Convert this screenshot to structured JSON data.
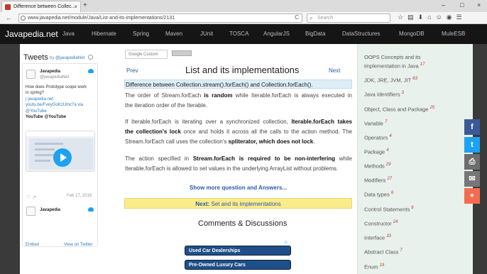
{
  "browser": {
    "tab_title": "Difference between Collec...",
    "tab_close": "×",
    "new_tab": "+",
    "url": "www.javapedia.net/module/Java/List-and-its-implementations/2131",
    "search_placeholder": "Search",
    "window_controls": [
      "–",
      "□",
      "×"
    ],
    "toolbar_icons": [
      "☆",
      "▤",
      "⬇",
      "⌂",
      "☺",
      "◉",
      "☰"
    ],
    "back": "←",
    "reload": "C"
  },
  "site": {
    "brand": "Javapedia.net",
    "nav": [
      "Java",
      "Hibernate",
      "Spring",
      "Maven",
      "JUnit",
      "TOSCA",
      "AngularJS",
      "BigData",
      "DataStructures",
      "MongoDB",
      "MuleESB"
    ]
  },
  "twitter": {
    "title": "Tweets",
    "by_prefix": "by",
    "handle": "@javapediaNet",
    "tweet_name": "Javapedia",
    "tweet_handle": "@javapediaNet",
    "tweet_lines": [
      "How does Prototype scope work",
      "in spring?"
    ],
    "tweet_link_lines": [
      "| javapedia.net",
      "youtu.be/FveyGoKzUmc?a via"
    ],
    "tweet_via": "@YouTube",
    "card_source": "YouTube @YouTube",
    "actions": "♡ ↗",
    "date": "Feb 17, 2018",
    "next_name": "Javapedia",
    "embed": "Embed",
    "view": "View on Twitter"
  },
  "main": {
    "search_label": "Google Custom",
    "prev": "Prev",
    "next": "Next",
    "title": "List and its implementations",
    "highlight": "Difference between Collection.stream().forEach() and Collection.forEach().",
    "p1": [
      [
        "The order of Stream.forEach ",
        "is random",
        " while Iterable.forEach is always executed in"
      ],
      [
        "the iteration order of the Iterable."
      ]
    ],
    "p2": [
      [
        "If Iterable.forEach is iterating over a synchronized collection, ",
        "Iterable.forEach takes",
        ""
      ],
      [
        "",
        "the collection's lock",
        " once and holds it across all the calls to the action method. The"
      ],
      [
        "Stream.forEach call uses the collection's ",
        "spliterator, which does not lock",
        "."
      ]
    ],
    "p3": [
      [
        "The action specified in ",
        "Stream.forEach is required to be non-interfering",
        " while"
      ],
      [
        "Iterable.forEach is allowed to set values in the underlying ArrayList without problems."
      ]
    ],
    "show_more": "Show more question and Answers...",
    "next_prefix": "Next:",
    "next_title": "Set and its implementations",
    "comments": "Comments & Discussions",
    "ad_buttons": [
      "Used Car Dealerships",
      "Pre-Owned Luxury Cars"
    ]
  },
  "sidebar": {
    "items": [
      {
        "label": "OOPS Concepts and its",
        "count": ""
      },
      {
        "label": "implementation in Java",
        "count": "17"
      },
      {
        "label": "JDK, JRE, JVM, JIT",
        "count": "63"
      },
      {
        "label": "Java Identifiers",
        "count": "3"
      },
      {
        "label": "Object, Class and Package",
        "count": "25"
      },
      {
        "label": "Variable",
        "count": "7"
      },
      {
        "label": "Operators",
        "count": "4"
      },
      {
        "label": "Package",
        "count": "4"
      },
      {
        "label": "Methods",
        "count": "29"
      },
      {
        "label": "Modifiers",
        "count": "27"
      },
      {
        "label": "Data types",
        "count": "6"
      },
      {
        "label": "Control Statements",
        "count": "6"
      },
      {
        "label": "Constructor",
        "count": "24"
      },
      {
        "label": "Interface",
        "count": "33"
      },
      {
        "label": "Abstract Class",
        "count": "7"
      },
      {
        "label": "Enum",
        "count": "19"
      }
    ]
  },
  "share": [
    {
      "icon": "facebook-icon",
      "glyph": "f",
      "color": "#3b5998"
    },
    {
      "icon": "twitter-icon",
      "glyph": "t",
      "color": "#1da1f2"
    },
    {
      "icon": "print-icon",
      "glyph": "⎙",
      "color": "#6d6d6d"
    },
    {
      "icon": "email-icon",
      "glyph": "✉",
      "color": "#777777"
    },
    {
      "icon": "more-icon",
      "glyph": "+",
      "color": "#f26d4f"
    }
  ]
}
